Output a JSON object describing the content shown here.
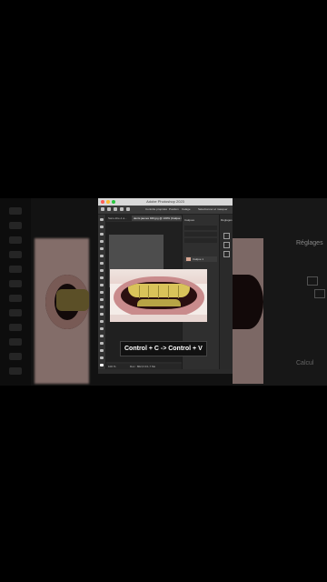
{
  "app": {
    "title": "Adobe Photoshop 2023"
  },
  "options_bar": {
    "opacity_label": "Contrôle propriété",
    "fill_label": "Position",
    "flow_label": "Calage",
    "ruler_label": "Sélectionner et masquer"
  },
  "tabs": [
    {
      "label": "Sans-titre-1 à..."
    },
    {
      "label": "dents jaunes 940.jpg @ 100% (Calque 1...)"
    }
  ],
  "caption": "Control + C -> Control + V",
  "panels": {
    "layers_tab": "Calques",
    "layer_name": "Calque 1",
    "side_title": "Réglages",
    "bg_right_title": "Réglages",
    "bg_right_foot": "Calcul"
  },
  "status": {
    "zoom": "100 %",
    "doc": "Doc : 802,6 K/1,7 Mo"
  }
}
